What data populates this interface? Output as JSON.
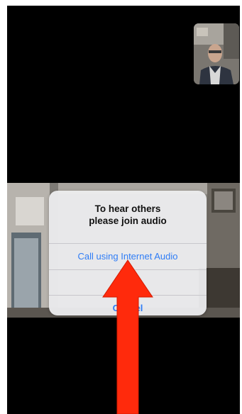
{
  "dialog": {
    "title_line1": "To hear others",
    "title_line2": "please join audio",
    "btn_internet_audio": "Call using Internet Audio",
    "btn_dial_in": "Dial in",
    "btn_cancel": "Cancel"
  },
  "colors": {
    "background": "#000000",
    "dialog_bg": "#eeeef0",
    "link_blue": "#2f7df6",
    "annotation_arrow": "#ff2a0c"
  },
  "annotation": {
    "arrow": "red-up-arrow"
  }
}
